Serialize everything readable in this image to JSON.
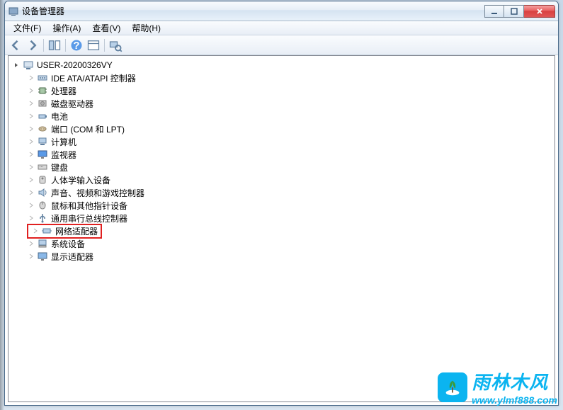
{
  "window": {
    "title": "设备管理器"
  },
  "menu": {
    "file": "文件(F)",
    "action": "操作(A)",
    "view": "查看(V)",
    "help": "帮助(H)"
  },
  "tree": {
    "root": "USER-20200326VY",
    "nodes": [
      {
        "label": "IDE ATA/ATAPI 控制器",
        "icon": "ide"
      },
      {
        "label": "处理器",
        "icon": "cpu"
      },
      {
        "label": "磁盘驱动器",
        "icon": "disk"
      },
      {
        "label": "电池",
        "icon": "battery"
      },
      {
        "label": "端口 (COM 和 LPT)",
        "icon": "port"
      },
      {
        "label": "计算机",
        "icon": "computer"
      },
      {
        "label": "监视器",
        "icon": "monitor"
      },
      {
        "label": "键盘",
        "icon": "keyboard"
      },
      {
        "label": "人体学输入设备",
        "icon": "hid"
      },
      {
        "label": "声音、视频和游戏控制器",
        "icon": "sound"
      },
      {
        "label": "鼠标和其他指针设备",
        "icon": "mouse"
      },
      {
        "label": "通用串行总线控制器",
        "icon": "usb"
      },
      {
        "label": "网络适配器",
        "icon": "network",
        "highlighted": true
      },
      {
        "label": "系统设备",
        "icon": "system"
      },
      {
        "label": "显示适配器",
        "icon": "display"
      }
    ]
  },
  "watermark": {
    "title": "雨林木风",
    "url": "www.ylmf888.com"
  }
}
